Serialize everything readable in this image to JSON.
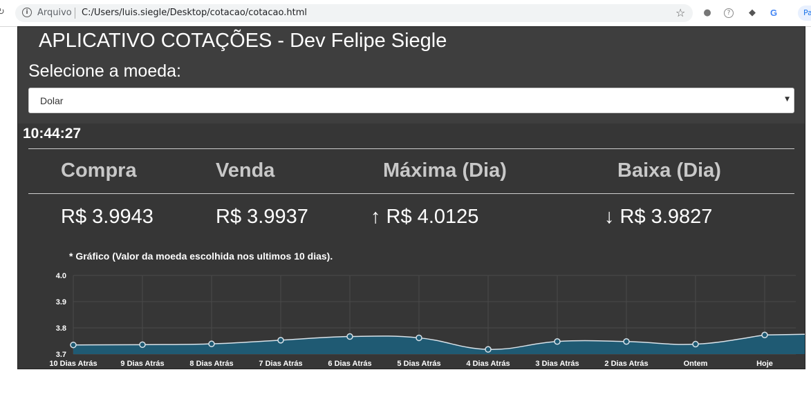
{
  "browser": {
    "url_label": "Arquivo",
    "url": "C:/Users/luis.siegle/Desktop/cotacao/cotacao.html",
    "profile_label": "Pa"
  },
  "app": {
    "title": "APLICATIVO COTAÇÕES - Dev Felipe Siegle",
    "select_label": "Selecione a moeda:",
    "selected_currency": "Dolar",
    "time": "10:44:27",
    "headers": [
      "Compra",
      "Venda",
      "Máxima (Dia)",
      "Baixa (Dia)"
    ],
    "values": [
      "R$ 3.9943",
      "R$ 3.9937",
      "↑ R$ 4.0125",
      "↓ R$ 3.9827"
    ],
    "chart_note": "* Gráfico (Valor da moeda escolhida nos ultimos 10 dias)."
  },
  "colors": {
    "background": "#3e3e3e",
    "panel": "#363636",
    "area_fill": "#1f5a73",
    "line": "#d9e3ea"
  },
  "chart_data": {
    "type": "area",
    "categories": [
      "10 Dias Atrás",
      "9 Dias Atrás",
      "8 Dias Atrás",
      "7 Dias Atrás",
      "6 Dias Atrás",
      "5 Dias Atrás",
      "4 Dias Atrás",
      "3 Dias Atrás",
      "2 Dias Atrás",
      "Ontem",
      "Hoje"
    ],
    "series": [
      {
        "values": [
          3.735,
          3.736,
          3.739,
          3.753,
          3.767,
          3.762,
          3.718,
          3.748,
          3.748,
          3.738,
          3.773
        ]
      }
    ],
    "yticks": [
      "4.0",
      "3.9",
      "3.8",
      "3.7"
    ],
    "ylim": [
      3.7,
      4.0
    ],
    "grid": true
  }
}
